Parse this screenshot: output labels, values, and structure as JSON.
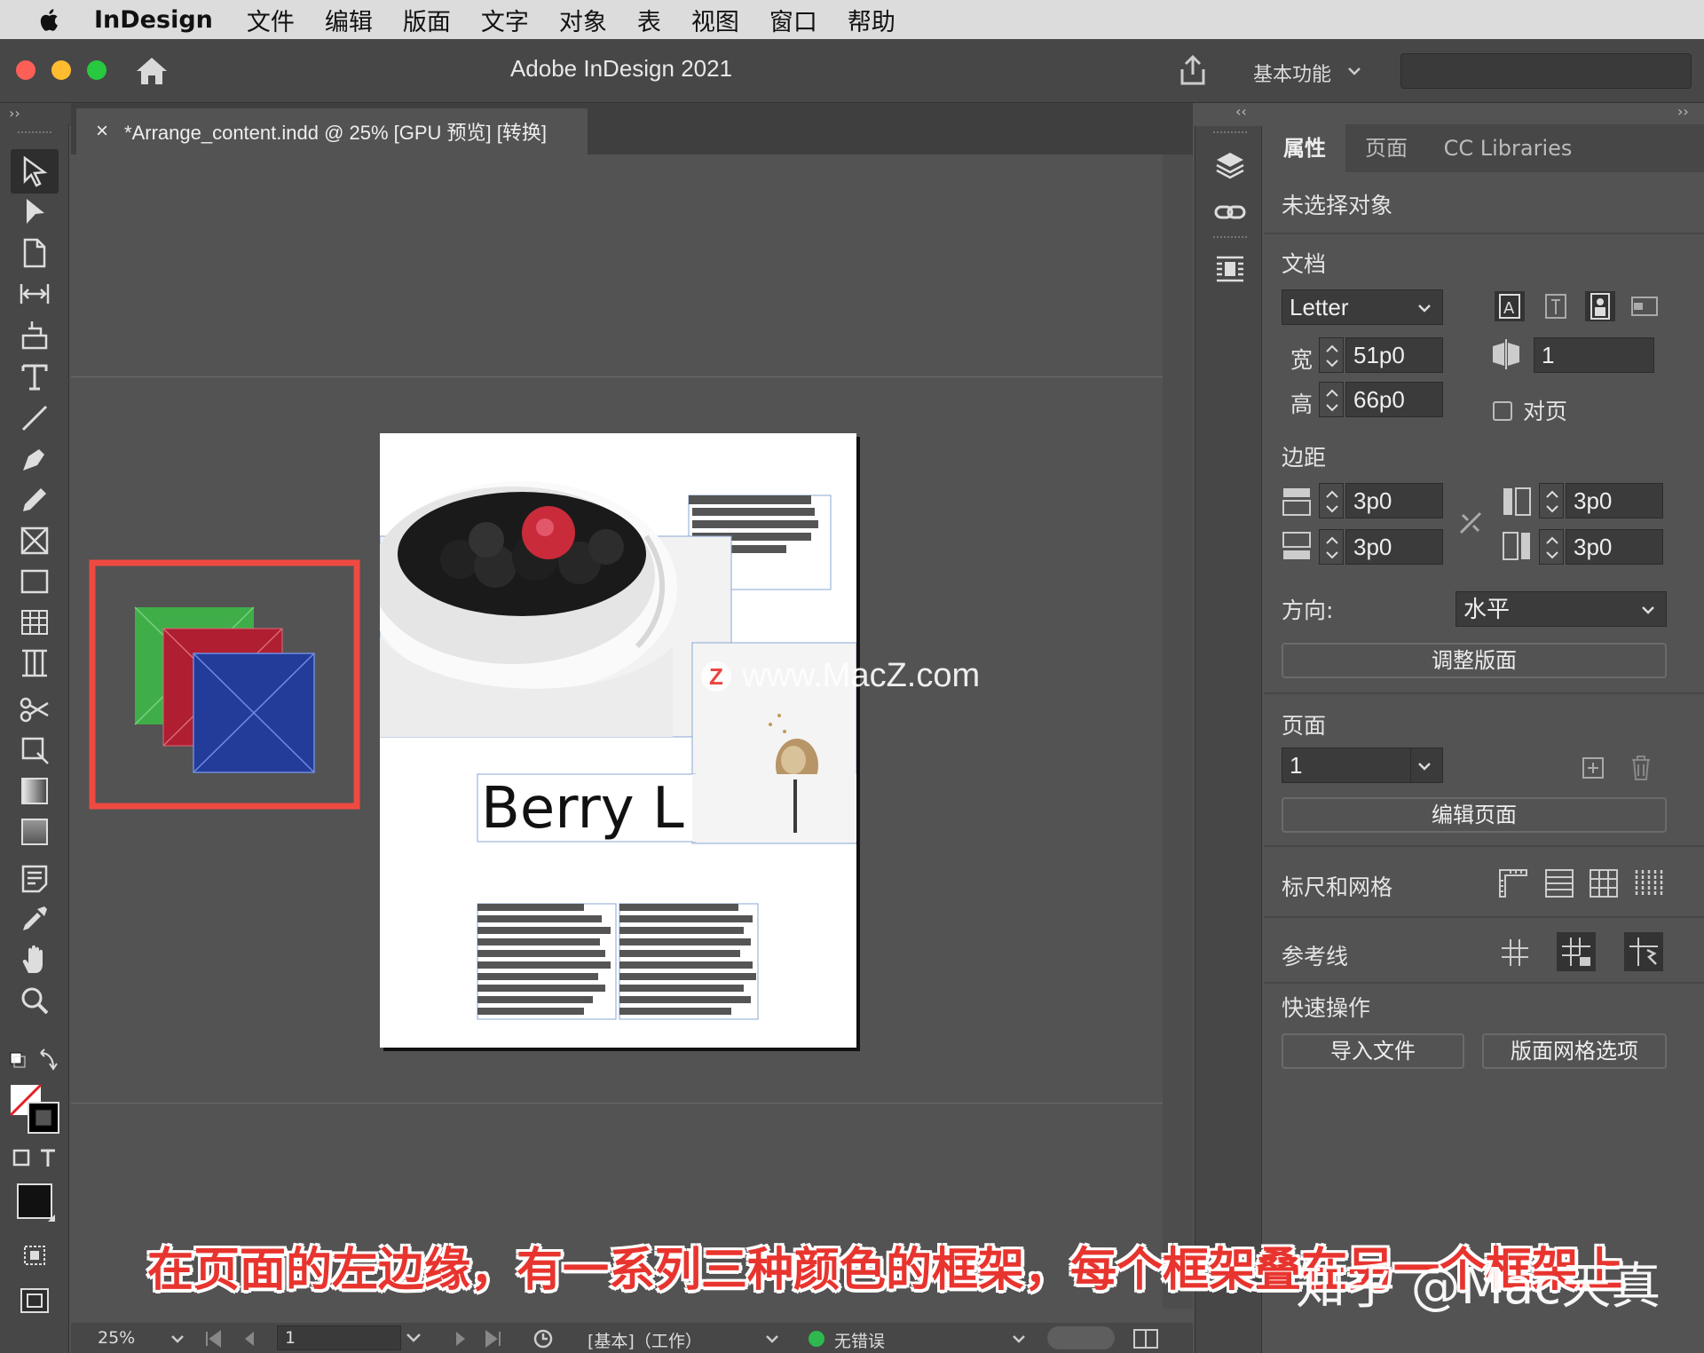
{
  "menubar": {
    "app": "InDesign",
    "items": [
      "文件",
      "编辑",
      "版面",
      "文字",
      "对象",
      "表",
      "视图",
      "窗口",
      "帮助"
    ]
  },
  "window": {
    "title": "Adobe InDesign 2021",
    "workspace": "基本功能"
  },
  "document_tab": {
    "close": "×",
    "title": "*Arrange_content.indd @ 25% [GPU 预览] [转换]"
  },
  "collapse": {
    "left": "››",
    "mid": "‹‹",
    "right": "››"
  },
  "page_content": {
    "headline": "Berry L"
  },
  "panel": {
    "tabs": [
      "属性",
      "页面",
      "CC Libraries"
    ],
    "selection_status": "未选择对象",
    "document": {
      "section": "文档",
      "preset": "Letter",
      "width_label": "宽",
      "width": "51p0",
      "height_label": "高",
      "height": "66p0",
      "pages": "1",
      "facing_label": "对页"
    },
    "margins": {
      "section": "边距",
      "top": "3p0",
      "bottom": "3p0",
      "left": "3p0",
      "right": "3p0"
    },
    "orientation": {
      "label": "方向:",
      "value": "水平"
    },
    "adjust_layout": "调整版面",
    "pages_section": {
      "label": "页面",
      "value": "1",
      "edit_page": "编辑页面"
    },
    "rulers_grids": "标尺和网格",
    "guides": "参考线",
    "quick_actions": {
      "label": "快速操作",
      "import": "导入文件",
      "layout_grid": "版面网格选项"
    }
  },
  "statusbar": {
    "zoom": "25%",
    "page": "1",
    "profile": "[基本]（工作）",
    "errors": "无错误"
  },
  "overlays": {
    "caption": "在页面的左边缘，有一系列三种颜色的框架，每个框架叠在另一个框架上",
    "watermark": "知乎 @Mac天真",
    "macz_badge": "Z",
    "macz": "www.MacZ.com"
  },
  "colors": {
    "highlight": "#ef4a41",
    "frame_green": "#3fae49",
    "frame_red": "#b01e31",
    "frame_blue": "#233c99",
    "caption_red": "#e8342e"
  }
}
